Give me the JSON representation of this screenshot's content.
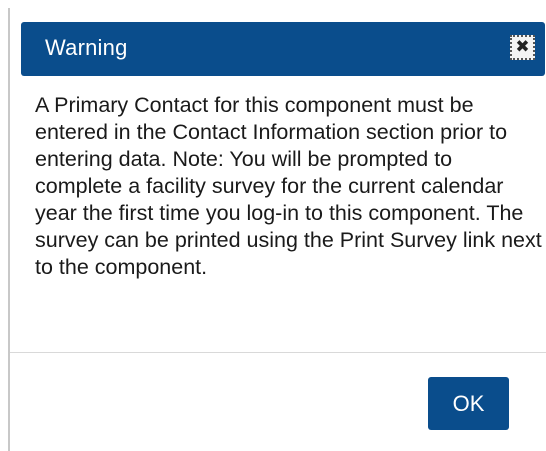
{
  "dialog": {
    "title": "Warning",
    "close_icon": "close-icon",
    "message": "A Primary Contact for this component must be entered in the Contact Information section prior to entering data. Note: You will be prompted to complete a facility survey for the current calendar year the first time you log-in to this component. The survey can be printed using the Print Survey link next to the component.",
    "ok_label": "OK"
  },
  "colors": {
    "titlebar": "#0a4d8c",
    "button": "#0a4d8c",
    "text": "#1a1a1a"
  }
}
